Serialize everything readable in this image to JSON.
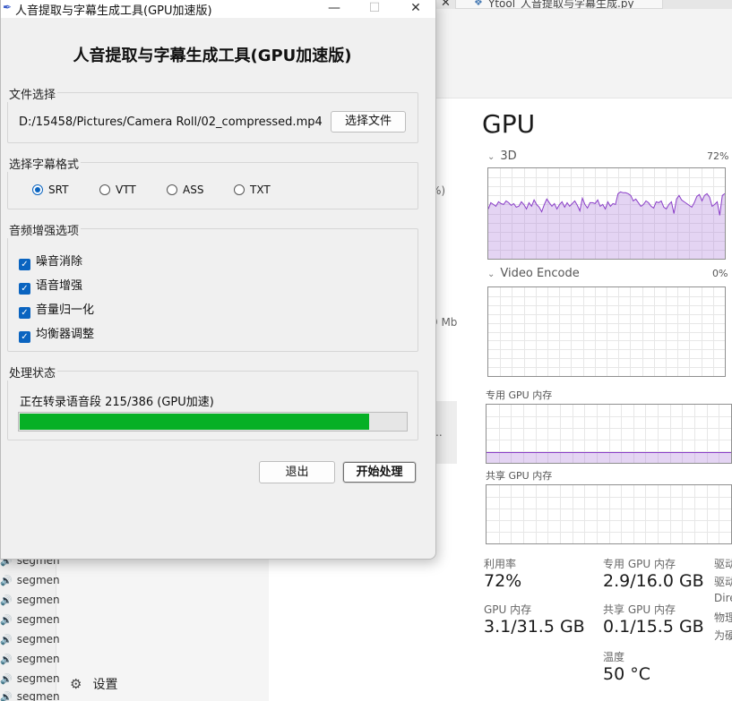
{
  "background": {
    "editor_tab": {
      "label": "Ytool_人音提取与字幕生成.py"
    },
    "explorer": {
      "segments": [
        "segmen",
        "segmen",
        "segmen",
        "segmen",
        "segmen",
        "segmen",
        "segmen",
        "segmen"
      ],
      "settings_label": "设置"
    },
    "task_manager": {
      "partial_percent": "%)",
      "partial_mb": "9 Mb",
      "partial_dots": "..",
      "title": "GPU",
      "graphs": {
        "three_d": {
          "label": "3D",
          "value": "72%"
        },
        "video_encode": {
          "label": "Video Encode",
          "value": "0%"
        },
        "dedicated_memory": {
          "label": "专用 GPU 内存"
        },
        "shared_memory": {
          "label": "共享 GPU 内存"
        }
      },
      "stats": {
        "utilization_label": "利用率",
        "utilization_value": "72%",
        "dedicated_label": "专用 GPU 内存",
        "dedicated_value": "2.9/16.0 GB",
        "gpu_memory_label": "GPU 内存",
        "gpu_memory_value": "3.1/31.5 GB",
        "shared_label": "共享 GPU 内存",
        "shared_value": "0.1/15.5 GB",
        "temp_label": "温度",
        "temp_value": "50 °C",
        "side_1": "驱动",
        "side_2": "驱动",
        "side_3": "Dire",
        "side_4": "物理",
        "side_5": "为硬"
      },
      "chart_data": {
        "type": "area",
        "title": "3D",
        "ylim": [
          0,
          100
        ],
        "values": [
          55,
          62,
          60,
          58,
          63,
          61,
          60,
          64,
          62,
          59,
          61,
          57,
          58,
          63,
          60,
          55,
          62,
          58,
          65,
          60,
          57,
          52,
          60,
          66,
          62,
          58,
          61,
          55,
          60,
          63,
          57,
          62,
          58,
          61,
          64,
          59,
          53,
          67,
          60,
          56,
          62,
          62,
          61,
          65,
          58,
          60,
          55,
          63,
          58,
          61,
          60,
          72,
          74,
          73,
          73,
          72,
          70,
          64,
          66,
          62,
          58,
          60,
          64,
          62,
          58,
          56,
          63,
          62,
          64,
          57,
          55,
          60,
          63,
          50,
          66,
          70,
          65,
          63,
          61,
          59,
          57,
          62,
          69,
          71,
          64,
          70,
          72,
          68,
          58,
          60,
          63,
          48,
          70,
          72
        ]
      }
    }
  },
  "dialog": {
    "window_title": "人音提取与字幕生成工具(GPU加速版)",
    "controls": {
      "minimize": "—",
      "maximize": "☐",
      "close": "✕"
    },
    "heading": "人音提取与字幕生成工具(GPU加速版)",
    "file_group": {
      "title": "文件选择",
      "path": "D:/15458/Pictures/Camera Roll/02_compressed.mp4",
      "button": "选择文件"
    },
    "format_group": {
      "title": "选择字幕格式",
      "options": [
        "SRT",
        "VTT",
        "ASS",
        "TXT"
      ],
      "selected": "SRT"
    },
    "audio_group": {
      "title": "音频增强选项",
      "options": [
        "噪音消除",
        "语音增强",
        "音量归一化",
        "均衡器调整"
      ]
    },
    "status_group": {
      "title": "处理状态",
      "text": "正在转录语音段 215/386 (GPU加速)",
      "progress": 0.9
    },
    "buttons": {
      "exit": "退出",
      "start": "开始处理"
    }
  }
}
